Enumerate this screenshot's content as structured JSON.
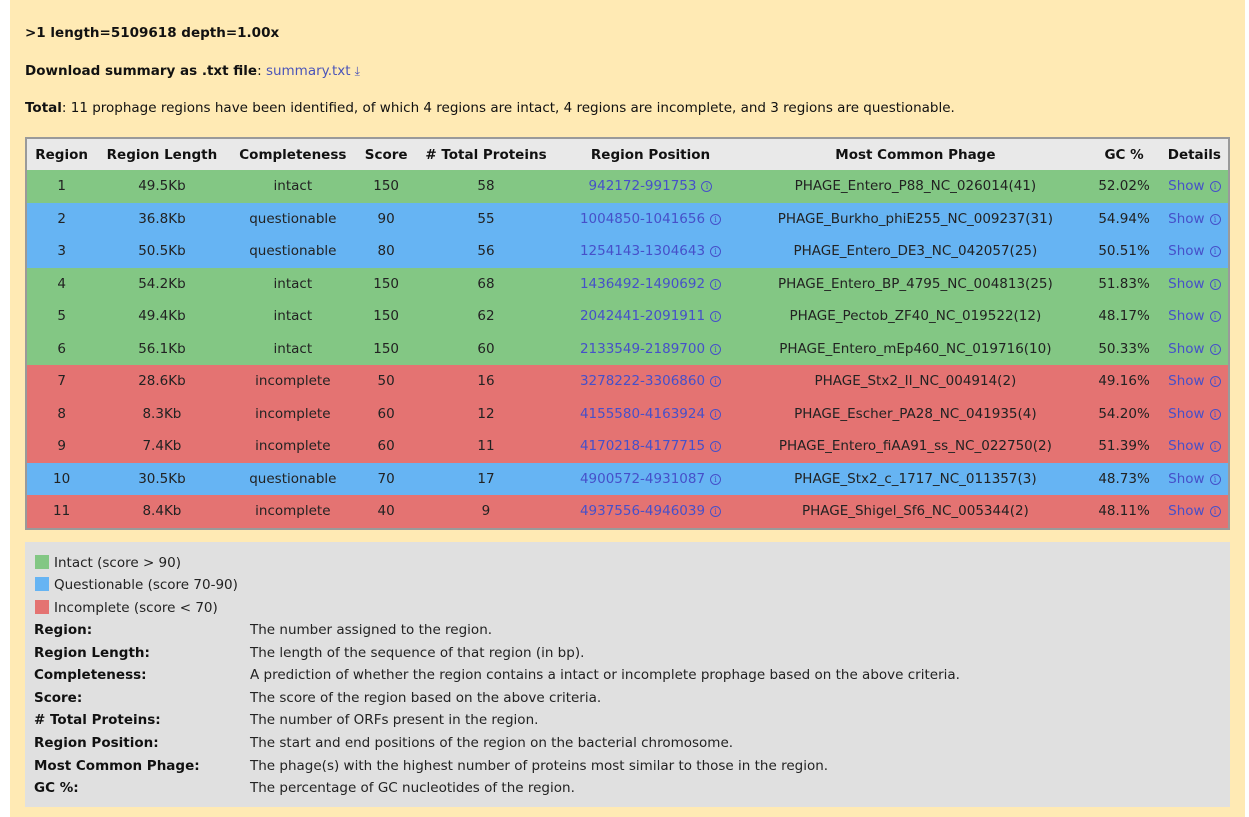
{
  "header": {
    "record_line": ">1 length=5109618 depth=1.00x",
    "download_label": "Download summary as .txt file",
    "download_colon": ":",
    "download_link": "summary.txt",
    "download_icon": "download-icon",
    "total_label": "Total",
    "total_text": ": 11 prophage regions have been identified, of which 4 regions are intact, 4 regions are incomplete, and 3 regions are questionable."
  },
  "table": {
    "columns": [
      "Region",
      "Region Length",
      "Completeness",
      "Score",
      "# Total Proteins",
      "Region Position",
      "Most Common Phage",
      "GC %",
      "Details"
    ],
    "show_label": "Show",
    "rows": [
      {
        "region": "1",
        "length": "49.5Kb",
        "completeness": "intact",
        "score": "150",
        "proteins": "58",
        "position": "942172-991753",
        "phage": "PHAGE_Entero_P88_NC_026014(41)",
        "gc": "52.02%"
      },
      {
        "region": "2",
        "length": "36.8Kb",
        "completeness": "questionable",
        "score": "90",
        "proteins": "55",
        "position": "1004850-1041656",
        "phage": "PHAGE_Burkho_phiE255_NC_009237(31)",
        "gc": "54.94%"
      },
      {
        "region": "3",
        "length": "50.5Kb",
        "completeness": "questionable",
        "score": "80",
        "proteins": "56",
        "position": "1254143-1304643",
        "phage": "PHAGE_Entero_DE3_NC_042057(25)",
        "gc": "50.51%"
      },
      {
        "region": "4",
        "length": "54.2Kb",
        "completeness": "intact",
        "score": "150",
        "proteins": "68",
        "position": "1436492-1490692",
        "phage": "PHAGE_Entero_BP_4795_NC_004813(25)",
        "gc": "51.83%"
      },
      {
        "region": "5",
        "length": "49.4Kb",
        "completeness": "intact",
        "score": "150",
        "proteins": "62",
        "position": "2042441-2091911",
        "phage": "PHAGE_Pectob_ZF40_NC_019522(12)",
        "gc": "48.17%"
      },
      {
        "region": "6",
        "length": "56.1Kb",
        "completeness": "intact",
        "score": "150",
        "proteins": "60",
        "position": "2133549-2189700",
        "phage": "PHAGE_Entero_mEp460_NC_019716(10)",
        "gc": "50.33%"
      },
      {
        "region": "7",
        "length": "28.6Kb",
        "completeness": "incomplete",
        "score": "50",
        "proteins": "16",
        "position": "3278222-3306860",
        "phage": "PHAGE_Stx2_II_NC_004914(2)",
        "gc": "49.16%"
      },
      {
        "region": "8",
        "length": "8.3Kb",
        "completeness": "incomplete",
        "score": "60",
        "proteins": "12",
        "position": "4155580-4163924",
        "phage": "PHAGE_Escher_PA28_NC_041935(4)",
        "gc": "54.20%"
      },
      {
        "region": "9",
        "length": "7.4Kb",
        "completeness": "incomplete",
        "score": "60",
        "proteins": "11",
        "position": "4170218-4177715",
        "phage": "PHAGE_Entero_fiAA91_ss_NC_022750(2)",
        "gc": "51.39%"
      },
      {
        "region": "10",
        "length": "30.5Kb",
        "completeness": "questionable",
        "score": "70",
        "proteins": "17",
        "position": "4900572-4931087",
        "phage": "PHAGE_Stx2_c_1717_NC_011357(3)",
        "gc": "48.73%"
      },
      {
        "region": "11",
        "length": "8.4Kb",
        "completeness": "incomplete",
        "score": "40",
        "proteins": "9",
        "position": "4937556-4946039",
        "phage": "PHAGE_Shigel_Sf6_NC_005344(2)",
        "gc": "48.11%"
      }
    ]
  },
  "legend": {
    "swatches": [
      {
        "label": "Intact (score > 90)",
        "color": "#83c784"
      },
      {
        "label": "Questionable (score 70-90)",
        "color": "#66b4f3"
      },
      {
        "label": "Incomplete (score < 70)",
        "color": "#e47372"
      }
    ],
    "definitions": [
      {
        "term": "Region:",
        "desc": "The number assigned to the region."
      },
      {
        "term": "Region Length:",
        "desc": "The length of the sequence of that region (in bp)."
      },
      {
        "term": "Completeness:",
        "desc": "A prediction of whether the region contains a intact or incomplete prophage based on the above criteria."
      },
      {
        "term": "Score:",
        "desc": "The score of the region based on the above criteria."
      },
      {
        "term": "# Total Proteins:",
        "desc": "The number of ORFs present in the region."
      },
      {
        "term": "Region Position:",
        "desc": "The start and end positions of the region on the bacterial chromosome."
      },
      {
        "term": "Most Common Phage:",
        "desc": "The phage(s) with the highest number of proteins most similar to those in the region."
      },
      {
        "term": "GC %:",
        "desc": "The percentage of GC nucleotides of the region."
      }
    ]
  },
  "colors": {
    "page_background": "#ffeab4",
    "intact": "#83c784",
    "questionable": "#66b4f3",
    "incomplete": "#e47372",
    "link": "#4650c9"
  }
}
